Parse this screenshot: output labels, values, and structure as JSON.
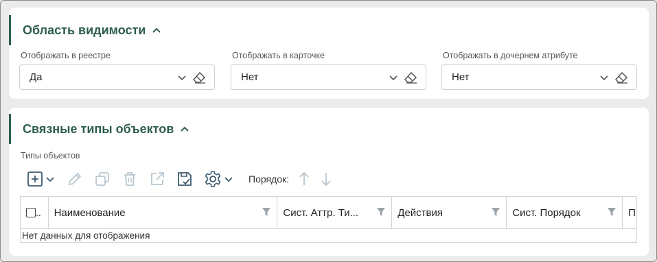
{
  "visibility": {
    "title": "Область видимости",
    "fields": [
      {
        "label": "Отображать в реестре",
        "value": "Да"
      },
      {
        "label": "Отображать в карточке",
        "value": "Нет"
      },
      {
        "label": "Отображать в дочернем атрибуте",
        "value": "Нет"
      }
    ]
  },
  "related": {
    "title": "Связные типы объектов",
    "sub_label": "Типы объектов",
    "order_label": "Порядок:",
    "columns": {
      "checkbox": "..",
      "name": "Наименование",
      "sys_attr": "Сист. Аттр. Ти...",
      "actions": "Действия",
      "sys_order": "Сист. Порядок",
      "extra": "П"
    },
    "empty_text": "Нет данных для отображения"
  },
  "colors": {
    "accent": "#2e5e4a",
    "icon_active": "#3d5a6e",
    "icon_disabled": "#b8c6cf"
  }
}
